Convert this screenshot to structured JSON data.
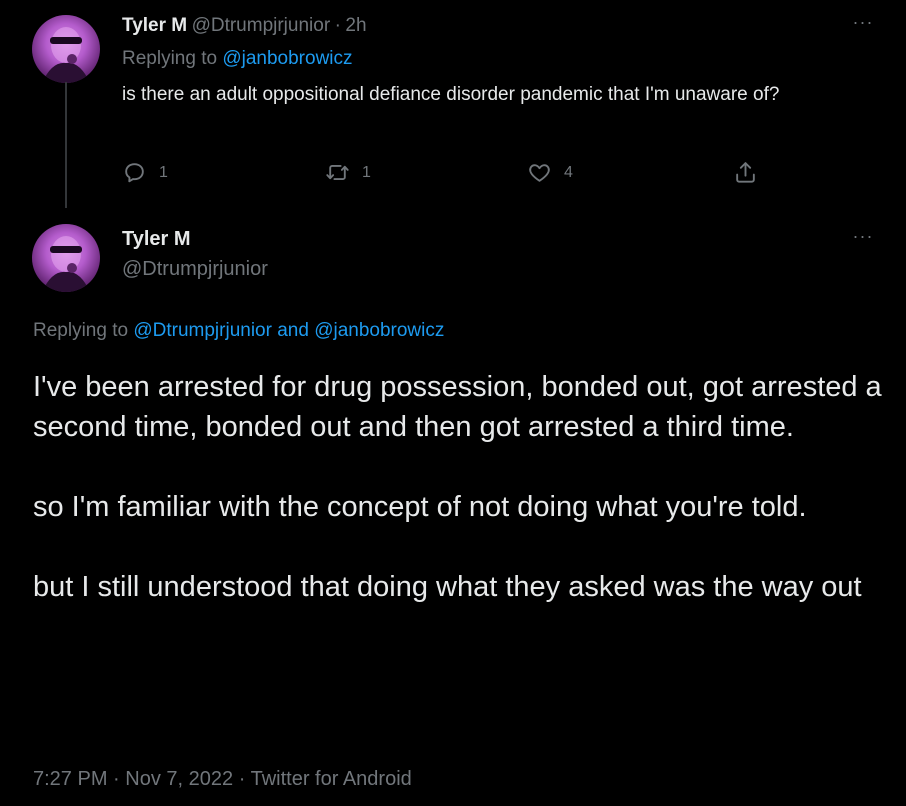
{
  "reply_tweet": {
    "author_name": "Tyler M",
    "author_handle": "@Dtrumpjrjunior",
    "separator": "·",
    "time": "2h",
    "replying_prefix": "Replying to",
    "replying_to": "@janbobrowicz",
    "text": "is there an adult oppositional defiance disorder pandemic that I'm unaware of?",
    "more_label": "···",
    "actions": {
      "reply_count": "1",
      "retweet_count": "1",
      "like_count": "4"
    }
  },
  "main_tweet": {
    "author_name": "Tyler M",
    "author_handle": "@Dtrumpjrjunior",
    "more_label": "···",
    "replying_prefix": "Replying to",
    "replying_to": "@Dtrumpjrjunior and @janbobrowicz",
    "text": "I've been arrested for drug possession, bonded out, got arrested a second time, bonded out and then got arrested a third time.\n\nso I'm familiar with the concept of not doing what you're told.\n\nbut I still understood that doing what they asked was the way out",
    "time": "7:27 PM",
    "separator_1": "·",
    "date": "Nov 7, 2022",
    "separator_2": "·",
    "source": "Twitter for Android"
  },
  "colors": {
    "background": "#000000",
    "text_primary": "#e7e9ea",
    "text_secondary": "#71767b",
    "link": "#1d9bf0",
    "thread_line": "#333639"
  },
  "icons": {
    "reply": "reply-icon",
    "retweet": "retweet-icon",
    "like": "heart-icon",
    "share": "share-icon",
    "more": "more-icon"
  }
}
